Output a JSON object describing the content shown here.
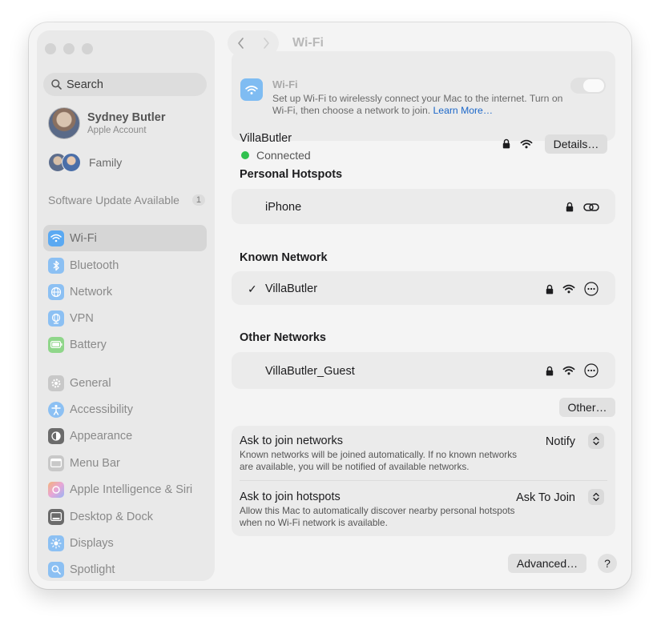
{
  "sidebar": {
    "search_placeholder": "Search",
    "user": {
      "name": "Sydney Butler",
      "subtitle": "Apple Account"
    },
    "family_label": "Family",
    "software_update": {
      "label": "Software Update Available",
      "count": "1"
    },
    "items": [
      {
        "label": "Wi-Fi",
        "icon": "wifi-icon",
        "color": "#5aa9f2",
        "active": true
      },
      {
        "label": "Bluetooth",
        "icon": "bluetooth-icon",
        "color": "#8cc0f3"
      },
      {
        "label": "Network",
        "icon": "globe-icon",
        "color": "#8cc0f3"
      },
      {
        "label": "VPN",
        "icon": "vpn-globe-icon",
        "color": "#8cc0f3"
      },
      {
        "label": "Battery",
        "icon": "battery-icon",
        "color": "#8fd68a"
      },
      {
        "label": "General",
        "icon": "gear-icon",
        "color": "#c8c8c8"
      },
      {
        "label": "Accessibility",
        "icon": "accessibility-icon",
        "color": "#8cc0f3"
      },
      {
        "label": "Appearance",
        "icon": "appearance-icon",
        "color": "#6b6b6b"
      },
      {
        "label": "Menu Bar",
        "icon": "menu-bar-icon",
        "color": "#c8c8c8"
      },
      {
        "label": "Apple Intelligence & Siri",
        "icon": "siri-icon",
        "color": "#e8a6d6"
      },
      {
        "label": "Desktop & Dock",
        "icon": "dock-icon",
        "color": "#6b6b6b"
      },
      {
        "label": "Displays",
        "icon": "sun-icon",
        "color": "#8cc0f3"
      },
      {
        "label": "Spotlight",
        "icon": "magnifier-icon",
        "color": "#8cc0f3"
      }
    ]
  },
  "header": {
    "title": "Wi-Fi"
  },
  "wifi": {
    "heading": "Wi-Fi",
    "description": "Set up Wi-Fi to wirelessly connect your Mac to the internet. Turn on Wi-Fi, then choose a network to join.",
    "learn_more": "Learn More…",
    "current_network": "VillaButler",
    "status": "Connected",
    "details_label": "Details…"
  },
  "personal_hotspots": {
    "title": "Personal Hotspots",
    "items": [
      {
        "name": "iPhone"
      }
    ]
  },
  "known_network": {
    "title": "Known Network",
    "items": [
      {
        "name": "VillaButler",
        "check": "✓"
      }
    ]
  },
  "other_networks": {
    "title": "Other Networks",
    "items": [
      {
        "name": "VillaButler_Guest"
      }
    ],
    "other_button": "Other…"
  },
  "settings": [
    {
      "title": "Ask to join networks",
      "description": "Known networks will be joined automatically. If no known networks are available, you will be notified of available networks.",
      "value": "Notify"
    },
    {
      "title": "Ask to join hotspots",
      "description": "Allow this Mac to automatically discover nearby personal hotspots when no Wi-Fi network is available.",
      "value": "Ask To Join"
    }
  ],
  "footer": {
    "advanced_label": "Advanced…",
    "help_label": "?"
  },
  "colors": {
    "accent": "#1b67c9",
    "connected": "#31c14f"
  }
}
